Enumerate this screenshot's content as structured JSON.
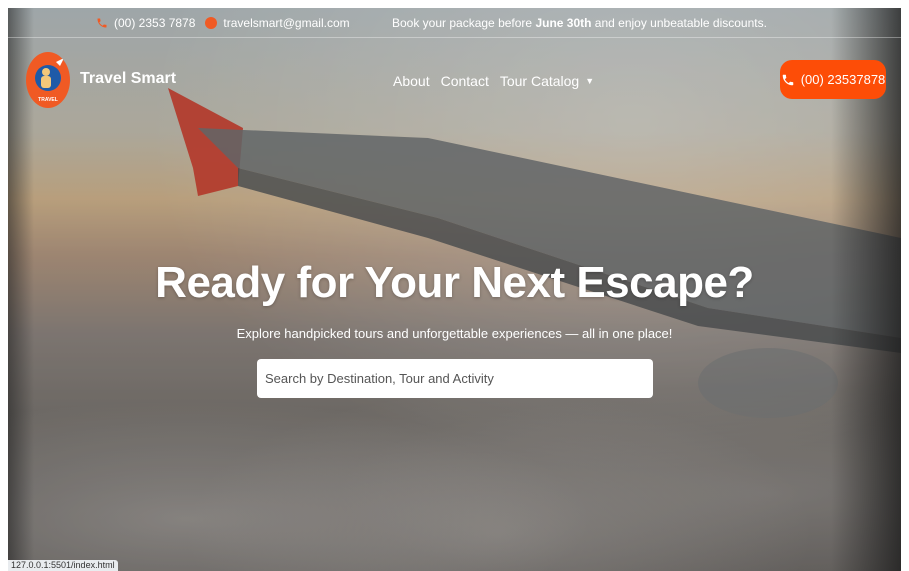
{
  "topbar": {
    "phone": "(00) 2353 7878",
    "email": "travelsmart@gmail.com",
    "promo_prefix": "Book your package before",
    "promo_date": "June 30th",
    "promo_suffix": "and enjoy unbeatable discounts."
  },
  "brand": {
    "name": "Travel Smart",
    "logo_text": "TRAVEL"
  },
  "nav": {
    "items": [
      "About",
      "Contact",
      "Tour Catalog"
    ]
  },
  "call_button": {
    "label": "(00) 23537878",
    "icon": "phone-icon"
  },
  "hero": {
    "title": "Ready for Your Next Escape?",
    "subtitle": "Explore handpicked tours and unforgettable experiences — all in one place!",
    "search_placeholder": "Search by Destination, Tour and Activity"
  },
  "status_bar": {
    "url": "127.0.0.1:5501/index.html"
  },
  "colors": {
    "accent": "#fd4d07",
    "text_on_hero": "#ffffff"
  }
}
